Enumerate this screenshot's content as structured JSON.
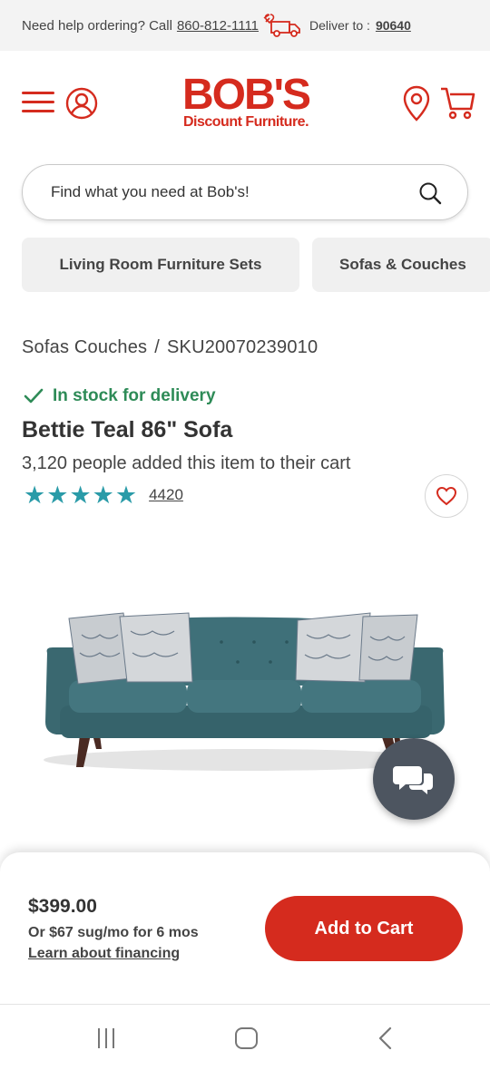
{
  "topbar": {
    "help_text": "Need help ordering? Call",
    "phone": "860-812-1111",
    "deliver_label": "Deliver to :",
    "zip": "90640"
  },
  "logo": {
    "line1": "BOB'S",
    "line2": "Discount Furniture."
  },
  "search": {
    "placeholder": "Find what you need at Bob's!"
  },
  "chips": [
    {
      "label": "Living Room Furniture Sets"
    },
    {
      "label": "Sofas & Couches"
    }
  ],
  "breadcrumb": {
    "category": "Sofas Couches",
    "separator": "/",
    "sku": "SKU20070239010"
  },
  "product": {
    "stock_status": "In stock for delivery",
    "title": "Bettie Teal 86\" Sofa",
    "cart_count_text": "3,120 people added this item to their cart",
    "rating": 5,
    "review_count": "4420"
  },
  "buy": {
    "price": "$399.00",
    "monthly": "Or $67 sug/mo for 6 mos",
    "financing_link": "Learn about financing",
    "add_to_cart": "Add to Cart"
  },
  "colors": {
    "brand_red": "#d52b1e",
    "star_teal": "#2a9ba8",
    "stock_green": "#2e8b57",
    "sofa_teal": "#3b6a73"
  },
  "icons": [
    "truck-icon",
    "menu-icon",
    "account-icon",
    "location-pin-icon",
    "cart-icon",
    "search-icon",
    "check-icon",
    "star-icon",
    "heart-icon",
    "chat-icon"
  ]
}
